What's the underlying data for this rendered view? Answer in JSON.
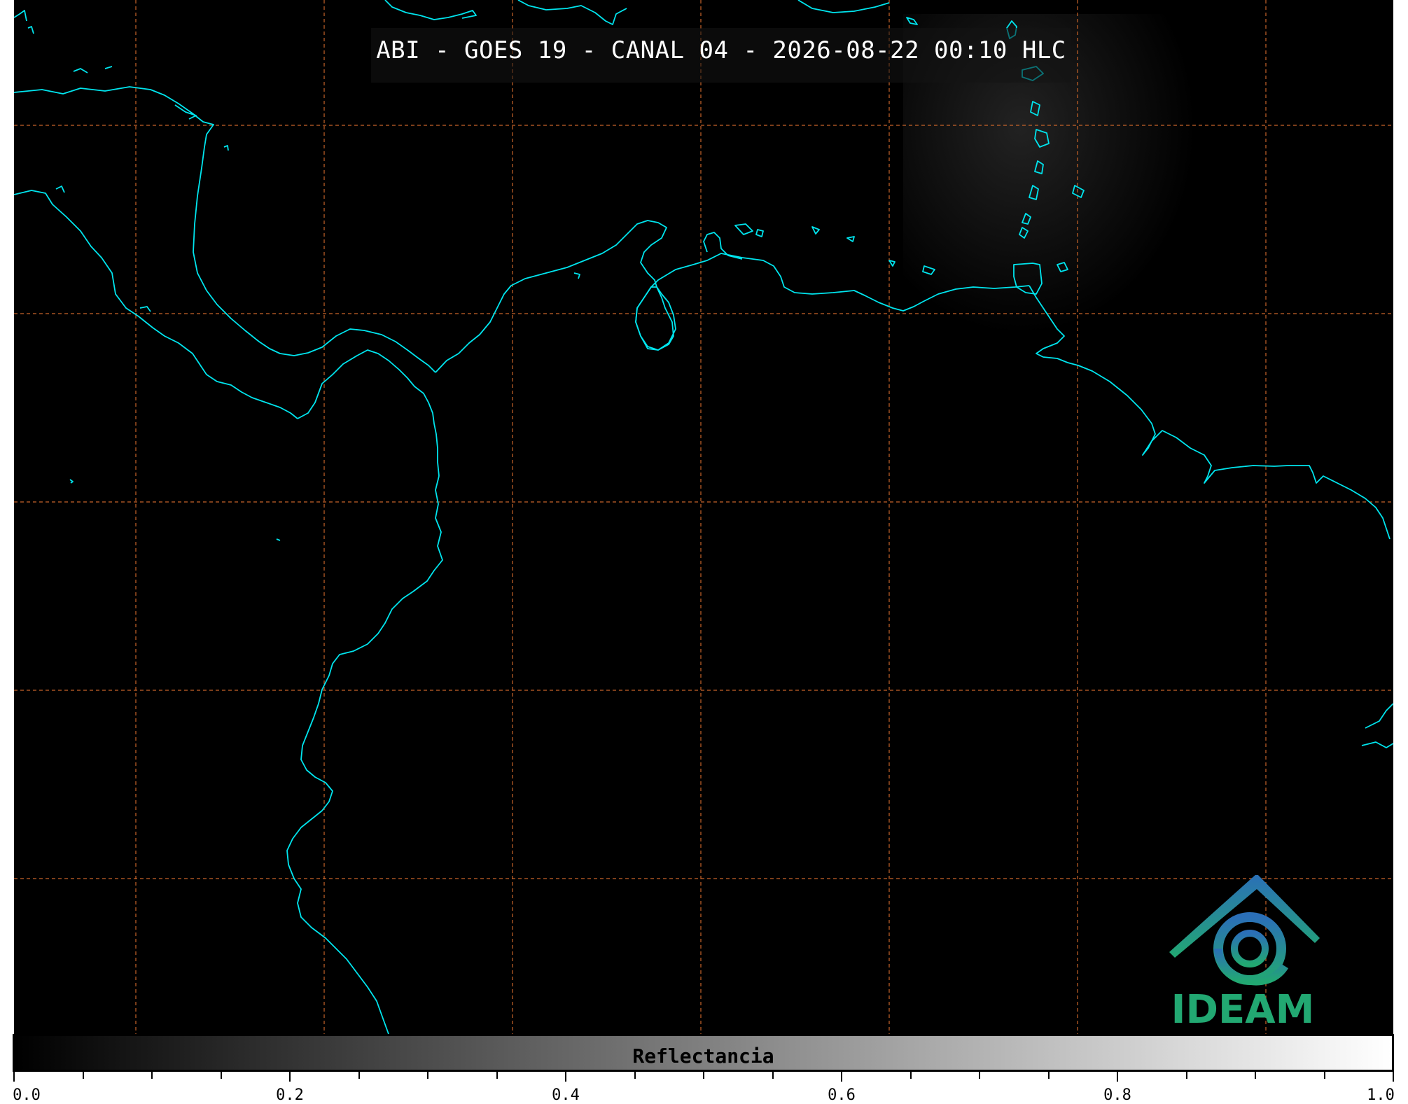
{
  "title": "ABI - GOES 19 - CANAL 04 - 2026-08-22 00:10 HLC",
  "colorbar": {
    "label": "Reflectancia",
    "range": [
      0.0,
      1.0
    ],
    "tick_labels": [
      "0.0",
      "0.2",
      "0.4",
      "0.6",
      "0.8",
      "1.0"
    ],
    "colormap": [
      "#000000",
      "#ffffff"
    ]
  },
  "logo": {
    "text": "IDEAM"
  },
  "colors": {
    "background": "#000000",
    "coastline": "#00e5ee",
    "gridlines": "#c8642a",
    "logo_green": "#22a872",
    "logo_blue": "#2b6fb8"
  },
  "map": {
    "gridlines": "dashed",
    "graticule_lines_visible": {
      "vertical": 7,
      "horizontal": 5
    }
  }
}
